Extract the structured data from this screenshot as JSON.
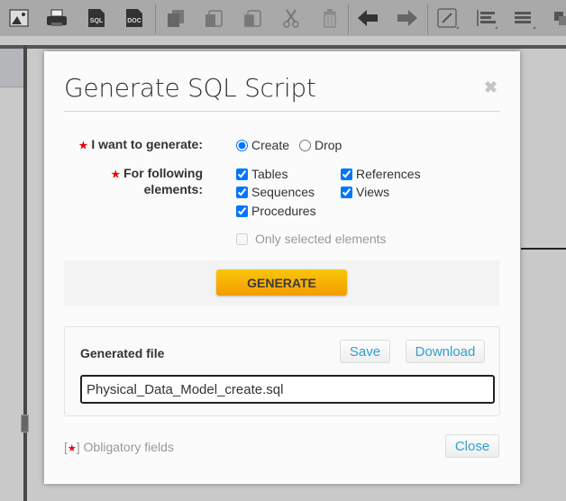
{
  "toolbar": {
    "icons": [
      {
        "name": "image-icon"
      },
      {
        "name": "print-icon"
      },
      {
        "name": "sql-export-icon",
        "label": "SQL"
      },
      {
        "name": "doc-export-icon",
        "label": "DOC"
      },
      {
        "name": "copy-icon"
      },
      {
        "name": "paste-icon"
      },
      {
        "name": "paste-special-icon"
      },
      {
        "name": "cut-icon"
      },
      {
        "name": "delete-icon"
      },
      {
        "name": "undo-icon"
      },
      {
        "name": "redo-icon"
      },
      {
        "name": "line-style-icon"
      },
      {
        "name": "align-icon"
      },
      {
        "name": "text-align-icon"
      },
      {
        "name": "arrange-icon"
      }
    ]
  },
  "dialog": {
    "title": "Generate SQL Script",
    "close_symbol": "✖",
    "generate_label": "I want to generate:",
    "generate_options": [
      {
        "label": "Create",
        "checked": true
      },
      {
        "label": "Drop",
        "checked": false
      }
    ],
    "elements_label_line1": "For following",
    "elements_label_line2": "elements:",
    "elements": [
      {
        "label": "Tables",
        "checked": true
      },
      {
        "label": "References",
        "checked": true
      },
      {
        "label": "Sequences",
        "checked": true
      },
      {
        "label": "Views",
        "checked": true
      },
      {
        "label": "Procedures",
        "checked": true
      }
    ],
    "only_selected": {
      "label": "Only selected elements",
      "checked": false,
      "disabled": true
    },
    "generate_button": "GENERATE",
    "generated_file_label": "Generated file",
    "save_button": "Save",
    "download_button": "Download",
    "file_name": "Physical_Data_Model_create.sql",
    "required_star": "★",
    "obligatory_note": "Obligatory fields",
    "close_button": "Close"
  },
  "colors": {
    "accent_link": "#2f9fd0",
    "generate_button": "#f7b500",
    "required_star": "#e00000"
  }
}
